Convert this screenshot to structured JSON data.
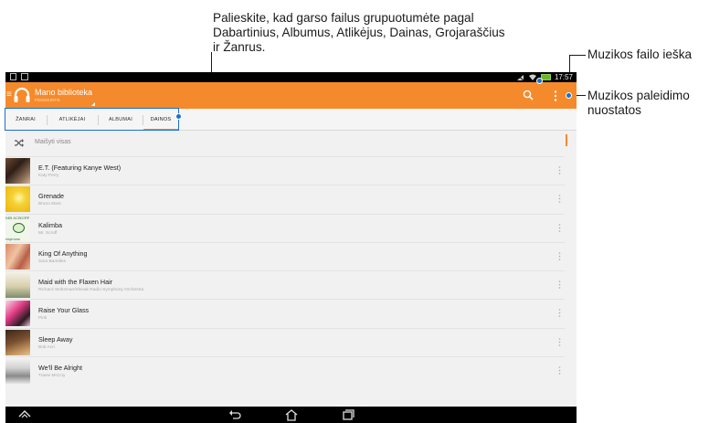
{
  "callouts": {
    "tabs": "Palieskite, kad garso failus grupuotumėte pagal Dabartinius, Albumus, Atlikėjus, Dainas, Grojaraščius ir Žanrus.",
    "search": "Muzikos failo ieška",
    "settings": "Muzikos paleidimo nuostatos"
  },
  "status_bar": {
    "time": "17:57"
  },
  "action_bar": {
    "title": "Mano biblioteka",
    "subtitle": "PENOKINTE",
    "icons": [
      "menu-icon",
      "headphones-icon",
      "search-icon",
      "overflow-menu-icon"
    ]
  },
  "tabs": [
    {
      "label": "ŽANRAI"
    },
    {
      "label": "ATLIKĖJAI"
    },
    {
      "label": "ALBUMAI"
    },
    {
      "label": "DAINOS",
      "active": true
    }
  ],
  "shuffle": {
    "label": "Maišyti visas"
  },
  "songs": [
    {
      "title": "E.T. (Featuring Kanye West)",
      "artist": "Katy Perry"
    },
    {
      "title": "Grenade",
      "artist": "Bruno Mars"
    },
    {
      "title": "Kalimba",
      "artist": "Mr. Scruff"
    },
    {
      "title": "King Of Anything",
      "artist": "Sara Bareilles"
    },
    {
      "title": "Maid with the Flaxen Hair",
      "artist": "Richard Stoltzman/Slovak Radio Symphony Orchestra"
    },
    {
      "title": "Raise Your Glass",
      "artist": "Pink"
    },
    {
      "title": "Sleep Away",
      "artist": "Bob Acri"
    },
    {
      "title": "We'll Be Alright",
      "artist": "Travie McCoy"
    }
  ],
  "album_art_text": {
    "kalimba_top": "MR SCRUFF",
    "kalimba_bottom": "ninja tuna"
  },
  "colors": {
    "accent": "#f58a2c",
    "callout_dot": "#1a6fd0"
  }
}
